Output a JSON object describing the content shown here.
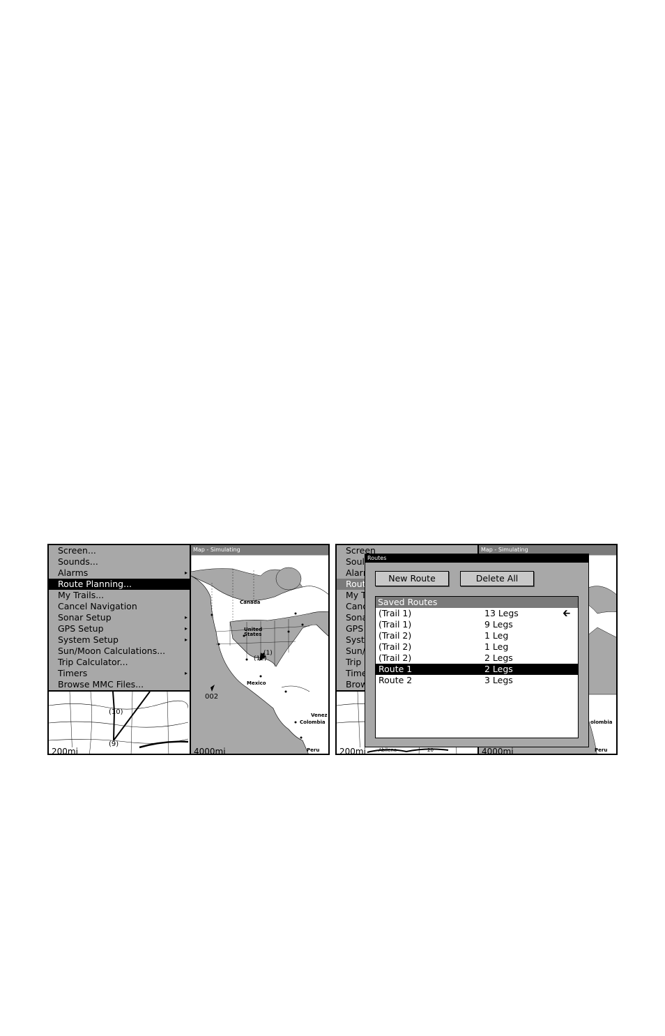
{
  "left_screen": {
    "menu_items": [
      {
        "label": "Screen...",
        "submenu": false,
        "selected": false
      },
      {
        "label": "Sounds...",
        "submenu": false,
        "selected": false
      },
      {
        "label": "Alarms",
        "submenu": true,
        "selected": false
      },
      {
        "label": "Route Planning...",
        "submenu": false,
        "selected": true
      },
      {
        "label": "My Trails...",
        "submenu": false,
        "selected": false
      },
      {
        "label": "Cancel Navigation",
        "submenu": false,
        "selected": false
      },
      {
        "label": "Sonar Setup",
        "submenu": true,
        "selected": false
      },
      {
        "label": "GPS Setup",
        "submenu": true,
        "selected": false
      },
      {
        "label": "System Setup",
        "submenu": true,
        "selected": false
      },
      {
        "label": "Sun/Moon Calculations...",
        "submenu": false,
        "selected": false
      },
      {
        "label": "Trip Calculator...",
        "submenu": false,
        "selected": false
      },
      {
        "label": "Timers",
        "submenu": true,
        "selected": false
      },
      {
        "label": "Browse MMC Files...",
        "submenu": false,
        "selected": false
      }
    ],
    "map_title": "Map - Simulating",
    "minimap": {
      "scale": "200mi",
      "waypoint_a": "(10)",
      "waypoint_b": "(9)"
    },
    "bigmap": {
      "scale": "4000mi",
      "label_canada": "Canada",
      "label_us": "United States",
      "label_mexico": "Mexico",
      "label_venezuela": "Venez",
      "label_colombia": "Colombia",
      "label_peru": "Peru",
      "waypoint_label": "002",
      "marker_a": "(12)",
      "marker_b": "(1)"
    }
  },
  "right_screen": {
    "menu_items": [
      "Screen",
      "Soul",
      "Aları",
      "Rout",
      "My T",
      "Canc",
      "Sona",
      "GPS",
      "Syst",
      "Sun/",
      "Trip",
      "Time",
      "Brow"
    ],
    "map_title": "Map - Simulating",
    "minimap": {
      "scale": "200mi",
      "town": "Abilene",
      "road": "20"
    },
    "bigmap": {
      "scale": "4000mi",
      "label_colombia": "olombia",
      "label_peru": "Peru"
    },
    "dialog": {
      "title": "Routes",
      "new_route": "New Route",
      "delete_all": "Delete All",
      "list_header": "Saved Routes",
      "routes": [
        {
          "name": "(Trail 1)",
          "legs": "13 Legs",
          "active": true,
          "selected": false
        },
        {
          "name": "(Trail 1)",
          "legs": "9 Legs",
          "active": false,
          "selected": false
        },
        {
          "name": "(Trail 2)",
          "legs": "1 Leg",
          "active": false,
          "selected": false
        },
        {
          "name": "(Trail 2)",
          "legs": "1 Leg",
          "active": false,
          "selected": false
        },
        {
          "name": "(Trail 2)",
          "legs": "2 Legs",
          "active": false,
          "selected": false
        },
        {
          "name": "Route 1",
          "legs": "2 Legs",
          "active": false,
          "selected": true
        },
        {
          "name": "Route 2",
          "legs": "3 Legs",
          "active": false,
          "selected": false
        }
      ]
    }
  }
}
